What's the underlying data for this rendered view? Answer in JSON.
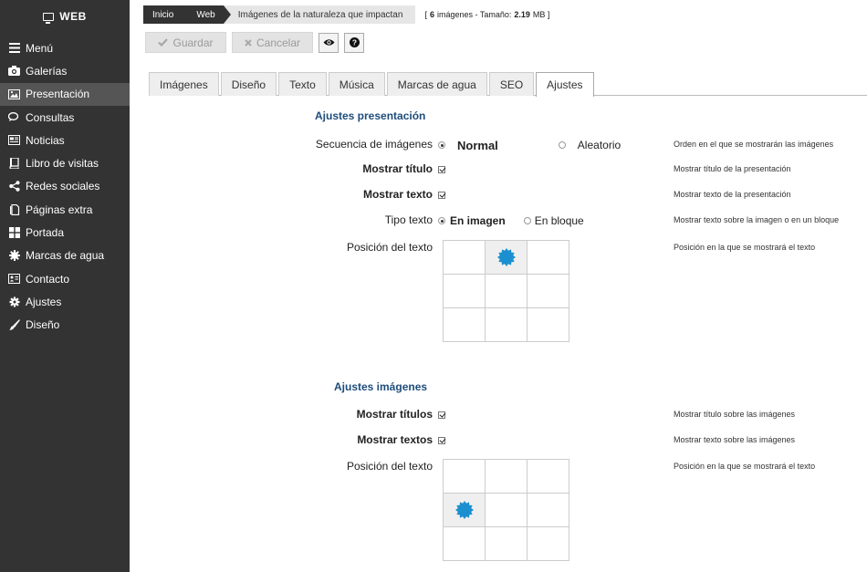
{
  "sidebar": {
    "brand": "WEB",
    "items": [
      {
        "label": "Menú",
        "icon": "menu-icon"
      },
      {
        "label": "Galerías",
        "icon": "camera-icon"
      },
      {
        "label": "Presentación",
        "icon": "picture-icon",
        "active": true
      },
      {
        "label": "Consultas",
        "icon": "comments-icon"
      },
      {
        "label": "Noticias",
        "icon": "newspaper-icon"
      },
      {
        "label": "Libro de visitas",
        "icon": "book-icon"
      },
      {
        "label": "Redes sociales",
        "icon": "share-icon"
      },
      {
        "label": "Páginas extra",
        "icon": "pages-icon"
      },
      {
        "label": "Portada",
        "icon": "grid-icon"
      },
      {
        "label": "Marcas de agua",
        "icon": "cog-icon"
      },
      {
        "label": "Contacto",
        "icon": "contact-card-icon"
      },
      {
        "label": "Ajustes",
        "icon": "gear-icon"
      },
      {
        "label": "Diseño",
        "icon": "brush-icon"
      }
    ]
  },
  "breadcrumb": {
    "items": [
      "Inicio",
      "Web",
      "Imágenes de la naturaleza que impactan"
    ],
    "info": {
      "open": "[",
      "count": "6",
      "count_suffix": "imágenes - Tamaño:",
      "size": "2.19",
      "size_suffix": "MB ]"
    }
  },
  "toolbar": {
    "save": "Guardar",
    "cancel": "Cancelar"
  },
  "tabs": [
    "Imágenes",
    "Diseño",
    "Texto",
    "Música",
    "Marcas de agua",
    "SEO",
    "Ajustes"
  ],
  "presentation": {
    "title": "Ajustes presentación",
    "sequence": {
      "label": "Secuencia de imágenes",
      "opt1": "Normal",
      "opt2": "Aleatorio",
      "hint": "Orden en el que se mostrarán las imágenes"
    },
    "show_title": {
      "label": "Mostrar título",
      "checked": true,
      "hint": "Mostrar título de la presentación"
    },
    "show_text": {
      "label": "Mostrar texto",
      "checked": true,
      "hint": "Mostrar texto de la presentación"
    },
    "text_type": {
      "label": "Tipo texto",
      "opt1": "En imagen",
      "opt2": "En bloque",
      "hint": "Mostrar texto sobre la imagen o en un bloque"
    },
    "text_position": {
      "label": "Posición del texto",
      "hint": "Posición en la que se mostrará el texto",
      "selected_cell": 1
    }
  },
  "images": {
    "title": "Ajustes imágenes",
    "show_titles": {
      "label": "Mostrar títulos",
      "checked": true,
      "hint": "Mostrar título sobre las imágenes"
    },
    "show_texts": {
      "label": "Mostrar textos",
      "checked": true,
      "hint": "Mostrar texto sobre las imágenes"
    },
    "text_position": {
      "label": "Posición del texto",
      "hint": "Posición en la que se mostrará el texto",
      "selected_cell": 3
    }
  },
  "colors": {
    "accent": "#1b8fcf",
    "sidebar": "#333333",
    "section_title": "#1e4d7b"
  }
}
